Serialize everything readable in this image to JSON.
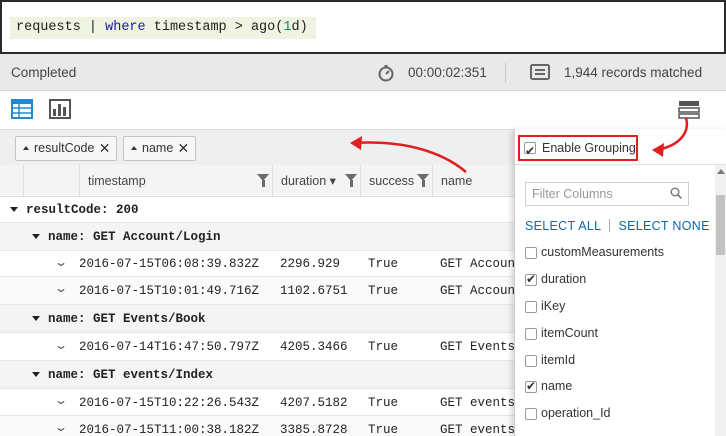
{
  "query": {
    "tokens": [
      {
        "text": "requests",
        "kind": "id"
      },
      {
        "text": " | ",
        "kind": "op"
      },
      {
        "text": "where",
        "kind": "kw"
      },
      {
        "text": " timestamp > ago(",
        "kind": "id"
      },
      {
        "text": "1",
        "kind": "num"
      },
      {
        "text": "d)",
        "kind": "id"
      }
    ]
  },
  "status": {
    "state": "Completed",
    "elapsed": "00:00:02:351",
    "records": "1,944 records matched"
  },
  "toolbar": {
    "table_icon": "table-view-icon",
    "chart_icon": "chart-view-icon",
    "settings_icon": "column-settings-icon"
  },
  "group_chips": [
    {
      "label": "resultCode",
      "close": "✕"
    },
    {
      "label": "name",
      "close": "✕"
    }
  ],
  "columns": [
    {
      "label": "timestamp"
    },
    {
      "label": "duration ▾"
    },
    {
      "label": "success"
    },
    {
      "label": "name"
    }
  ],
  "groups": [
    {
      "label": "resultCode: 200"
    },
    {
      "label": "name: GET Account/Login"
    },
    {
      "label": "name: GET Events/Book"
    },
    {
      "label": "name: GET events/Index"
    }
  ],
  "rows": [
    {
      "timestamp": "2016-07-15T06:08:39.832Z",
      "duration": "2296.929",
      "success": "True",
      "name": "GET Account"
    },
    {
      "timestamp": "2016-07-15T10:01:49.716Z",
      "duration": "1102.6751",
      "success": "True",
      "name": "GET Account"
    },
    {
      "timestamp": "2016-07-14T16:47:50.797Z",
      "duration": "4205.3466",
      "success": "True",
      "name": "GET Events/"
    },
    {
      "timestamp": "2016-07-15T10:22:26.543Z",
      "duration": "4207.5182",
      "success": "True",
      "name": "GET events/"
    },
    {
      "timestamp": "2016-07-15T11:00:38.182Z",
      "duration": "3385.8728",
      "success": "True",
      "name": "GET events/"
    }
  ],
  "panel": {
    "enable_grouping": "Enable Grouping",
    "enable_grouping_checked": true,
    "filter_placeholder": "Filter Columns",
    "select_all": "SELECT ALL",
    "select_none": "SELECT NONE",
    "columns": [
      {
        "label": "customMeasurements",
        "checked": false
      },
      {
        "label": "duration",
        "checked": true
      },
      {
        "label": "iKey",
        "checked": false
      },
      {
        "label": "itemCount",
        "checked": false
      },
      {
        "label": "itemId",
        "checked": false
      },
      {
        "label": "name",
        "checked": true
      },
      {
        "label": "operation_Id",
        "checked": false
      }
    ]
  },
  "colors": {
    "accent": "#1f8ad2",
    "annotation_red": "#e01f1f",
    "link_blue": "#0a6aa8",
    "editor_highlight": "#eef3e2"
  }
}
